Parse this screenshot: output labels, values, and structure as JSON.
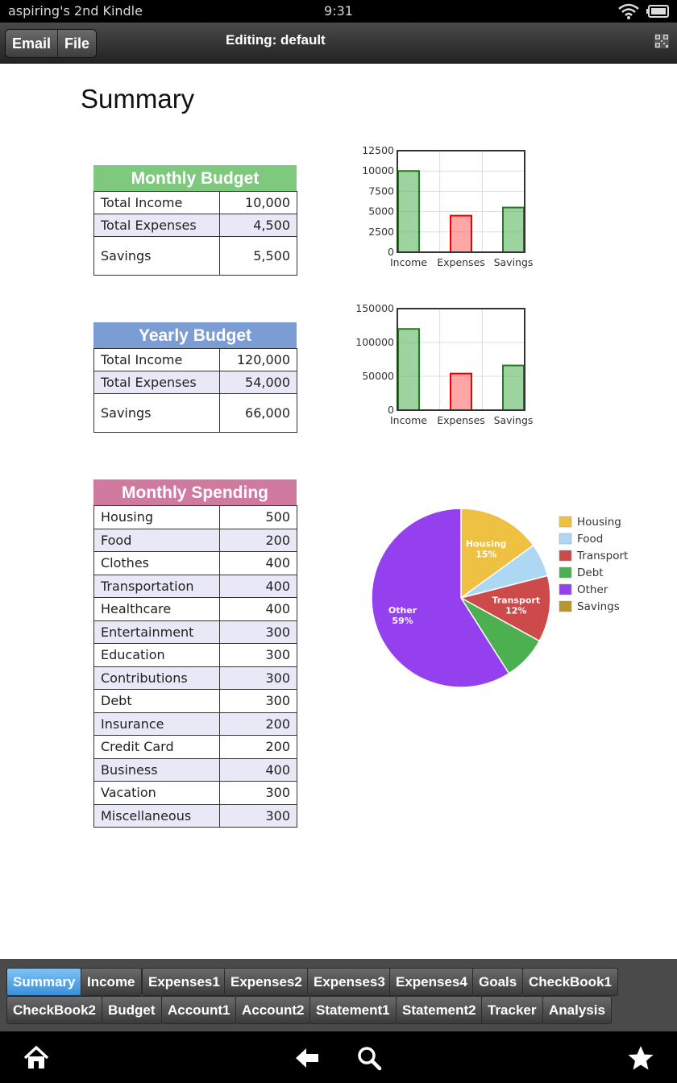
{
  "status_bar": {
    "device_name": "aspiring's 2nd Kindle",
    "time": "9:31"
  },
  "toolbar": {
    "email_label": "Email",
    "file_label": "File",
    "editing_label": "Editing: default"
  },
  "page": {
    "title": "Summary"
  },
  "monthly_budget": {
    "title": "Monthly Budget",
    "header_color": "#7fc97f",
    "rows": [
      {
        "label": "Total Income",
        "value": "10,000"
      },
      {
        "label": "Total Expenses",
        "value": "4,500"
      },
      {
        "label": "Savings",
        "value": "5,500"
      }
    ]
  },
  "yearly_budget": {
    "title": "Yearly Budget",
    "header_color": "#7b9dd3",
    "rows": [
      {
        "label": "Total Income",
        "value": "120,000"
      },
      {
        "label": "Total Expenses",
        "value": "54,000"
      },
      {
        "label": "Savings",
        "value": "66,000"
      }
    ]
  },
  "monthly_spending": {
    "title": "Monthly Spending",
    "header_color": "#d07a9f",
    "rows": [
      {
        "label": "Housing",
        "value": "500"
      },
      {
        "label": "Food",
        "value": "200"
      },
      {
        "label": "Clothes",
        "value": "400"
      },
      {
        "label": "Transportation",
        "value": "400"
      },
      {
        "label": "Healthcare",
        "value": "400"
      },
      {
        "label": "Entertainment",
        "value": "300"
      },
      {
        "label": "Education",
        "value": "300"
      },
      {
        "label": "Contributions",
        "value": "300"
      },
      {
        "label": "Debt",
        "value": "300"
      },
      {
        "label": "Insurance",
        "value": "200"
      },
      {
        "label": "Credit Card",
        "value": "200"
      },
      {
        "label": "Business",
        "value": "400"
      },
      {
        "label": "Vacation",
        "value": "300"
      },
      {
        "label": "Miscellaneous",
        "value": "300"
      }
    ]
  },
  "chart_data": [
    {
      "type": "bar",
      "categories": [
        "Income",
        "Expenses",
        "Savings"
      ],
      "values": [
        10000,
        4500,
        5500
      ],
      "colors": [
        "#4caf50",
        "#ff5c5c",
        "#4caf50"
      ],
      "yticks": [
        "0",
        "2500",
        "5000",
        "7500",
        "10000",
        "12500"
      ],
      "ylim": [
        0,
        12500
      ],
      "grid": true
    },
    {
      "type": "bar",
      "categories": [
        "Income",
        "Expenses",
        "Savings"
      ],
      "values": [
        120000,
        54000,
        66000
      ],
      "colors": [
        "#4caf50",
        "#ff5c5c",
        "#4caf50"
      ],
      "yticks": [
        "0",
        "50000",
        "100000",
        "150000"
      ],
      "ylim": [
        0,
        150000
      ],
      "grid": true
    },
    {
      "type": "pie",
      "slices": [
        {
          "label": "Housing",
          "value": 15,
          "color": "#eec142",
          "slice_label": "Housing",
          "pct_label": "15%"
        },
        {
          "label": "Food",
          "value": 6,
          "color": "#aed7f4",
          "slice_label": "",
          "pct_label": ""
        },
        {
          "label": "Transport",
          "value": 12,
          "color": "#cd4a4a",
          "slice_label": "Transport",
          "pct_label": "12%"
        },
        {
          "label": "Debt",
          "value": 8,
          "color": "#4caf50",
          "slice_label": "",
          "pct_label": ""
        },
        {
          "label": "Other",
          "value": 59,
          "color": "#9540ee",
          "slice_label": "Other",
          "pct_label": "59%"
        },
        {
          "label": "Savings",
          "value": 0,
          "color": "#b8952e",
          "slice_label": "",
          "pct_label": ""
        }
      ],
      "legend_position": "right"
    }
  ],
  "sheet_tabs": [
    {
      "label": "Summary",
      "active": true
    },
    {
      "label": "Income"
    },
    {
      "label": "Expenses1"
    },
    {
      "label": "Expenses2"
    },
    {
      "label": "Expenses3"
    },
    {
      "label": "Expenses4"
    },
    {
      "label": "Goals"
    },
    {
      "label": "CheckBook1"
    },
    {
      "label": "CheckBook2"
    },
    {
      "label": "Budget"
    },
    {
      "label": "Account1"
    },
    {
      "label": "Account2"
    },
    {
      "label": "Statement1"
    },
    {
      "label": "Statement2"
    },
    {
      "label": "Tracker"
    },
    {
      "label": "Analysis"
    }
  ],
  "nav_icons": [
    "home-icon",
    "back-icon",
    "search-icon",
    "favorites-icon"
  ]
}
